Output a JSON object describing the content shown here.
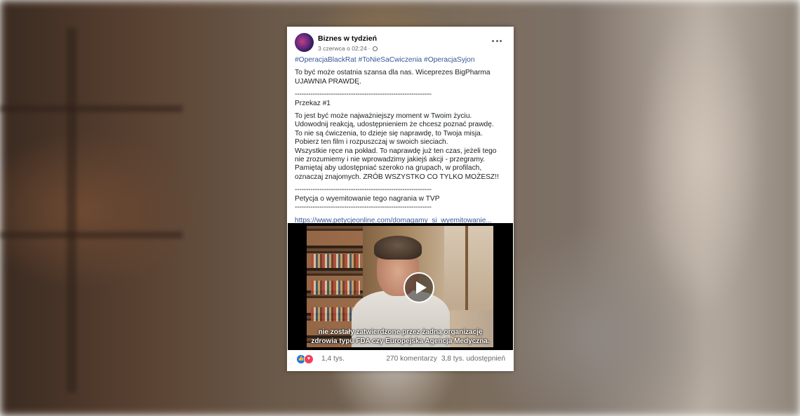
{
  "post": {
    "page_name": "Biznes w tydzień",
    "timestamp": "3 czerwca o 02:24",
    "hashtags": "#OperacjaBlackRat #ToNieSaCwiczenia #OperacjaSyjon",
    "intro": "To być może ostatnia szansa dla nas. Wiceprezes BigPharma UJAWNIA PRAWDĘ.",
    "separator": "-------------------------------------------------------------",
    "transfer_label": "Przekaz #1",
    "paragraph_1": "To jest być może najważniejszy moment w Twoim życiu. Udowodnij reakcją, udostępnieniem że chcesz poznać prawdę.",
    "paragraph_2": "To nie są ćwiczenia, to dzieje się naprawdę, to Twoja misja. Pobierz ten film i rozpuszczaj w swoich sieciach.",
    "paragraph_3": "Wszystkie ręce na pokład. To naprawdę już ten czas, jeżeli tego nie zrozumiemy i nie wprowadzimy jakiejś akcji - przegramy.",
    "paragraph_4": "Pamiętaj aby udostępniać szeroko na grupach, w profilach, oznaczaj znajomych. ZRÓB WSZYSTKO CO TYLKO MOŻESZ!!",
    "separator_2": "-------------------------------------------------------------",
    "petition_label": "Petycja o wyemitowanie tego nagrania w TVP",
    "separator_3": "-------------------------------------------------------------",
    "link": "https://www.petycjeonline.com/domagamy_si_wyemitowanie..."
  },
  "video": {
    "subtitle_line_1": "nie zostały zatwierdzone przez żadną organizację",
    "subtitle_line_2": "zdrowia typu FDA czy Europejska Agencja Medyczna."
  },
  "footer": {
    "reactions_count": "1,4 tys.",
    "comments": "270 komentarzy",
    "shares": "3,8 tys. udostępnień"
  },
  "colors": {
    "link": "#385898",
    "like": "#1877f2",
    "love": "#f33e58"
  }
}
